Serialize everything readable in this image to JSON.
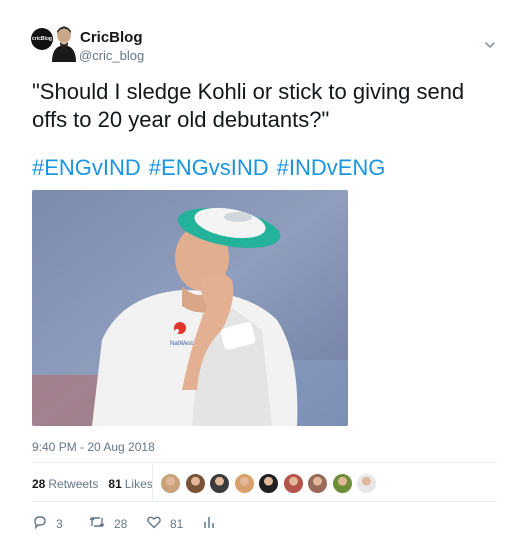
{
  "author": {
    "display_name": "CricBlog",
    "handle": "@cric_blog",
    "logo_text": "cricBlog"
  },
  "tweet": {
    "text": "\"Should I sledge Kohli or stick to giving send offs to 20 year old debutants?\"",
    "hashtags": [
      "#ENGvIND",
      "#ENGvsIND",
      "#INDvENG"
    ],
    "photo_logo": "NatWest",
    "timestamp": "9:40 PM - 20 Aug 2018"
  },
  "stats": {
    "retweets_count": "28",
    "retweets_label": "Retweets",
    "likes_count": "81",
    "likes_label": "Likes",
    "likers": [
      "#c9a27a",
      "#7a5236",
      "#3b3b3b",
      "#d8a06a",
      "#202020",
      "#b5544a",
      "#9a6b5a",
      "#6f8c3a",
      "#e8e8e8"
    ]
  },
  "actions": {
    "replies": "3",
    "retweets": "28",
    "likes": "81"
  },
  "colors": {
    "link": "#1b95e0",
    "secondary": "#657786",
    "text": "#14171a"
  }
}
